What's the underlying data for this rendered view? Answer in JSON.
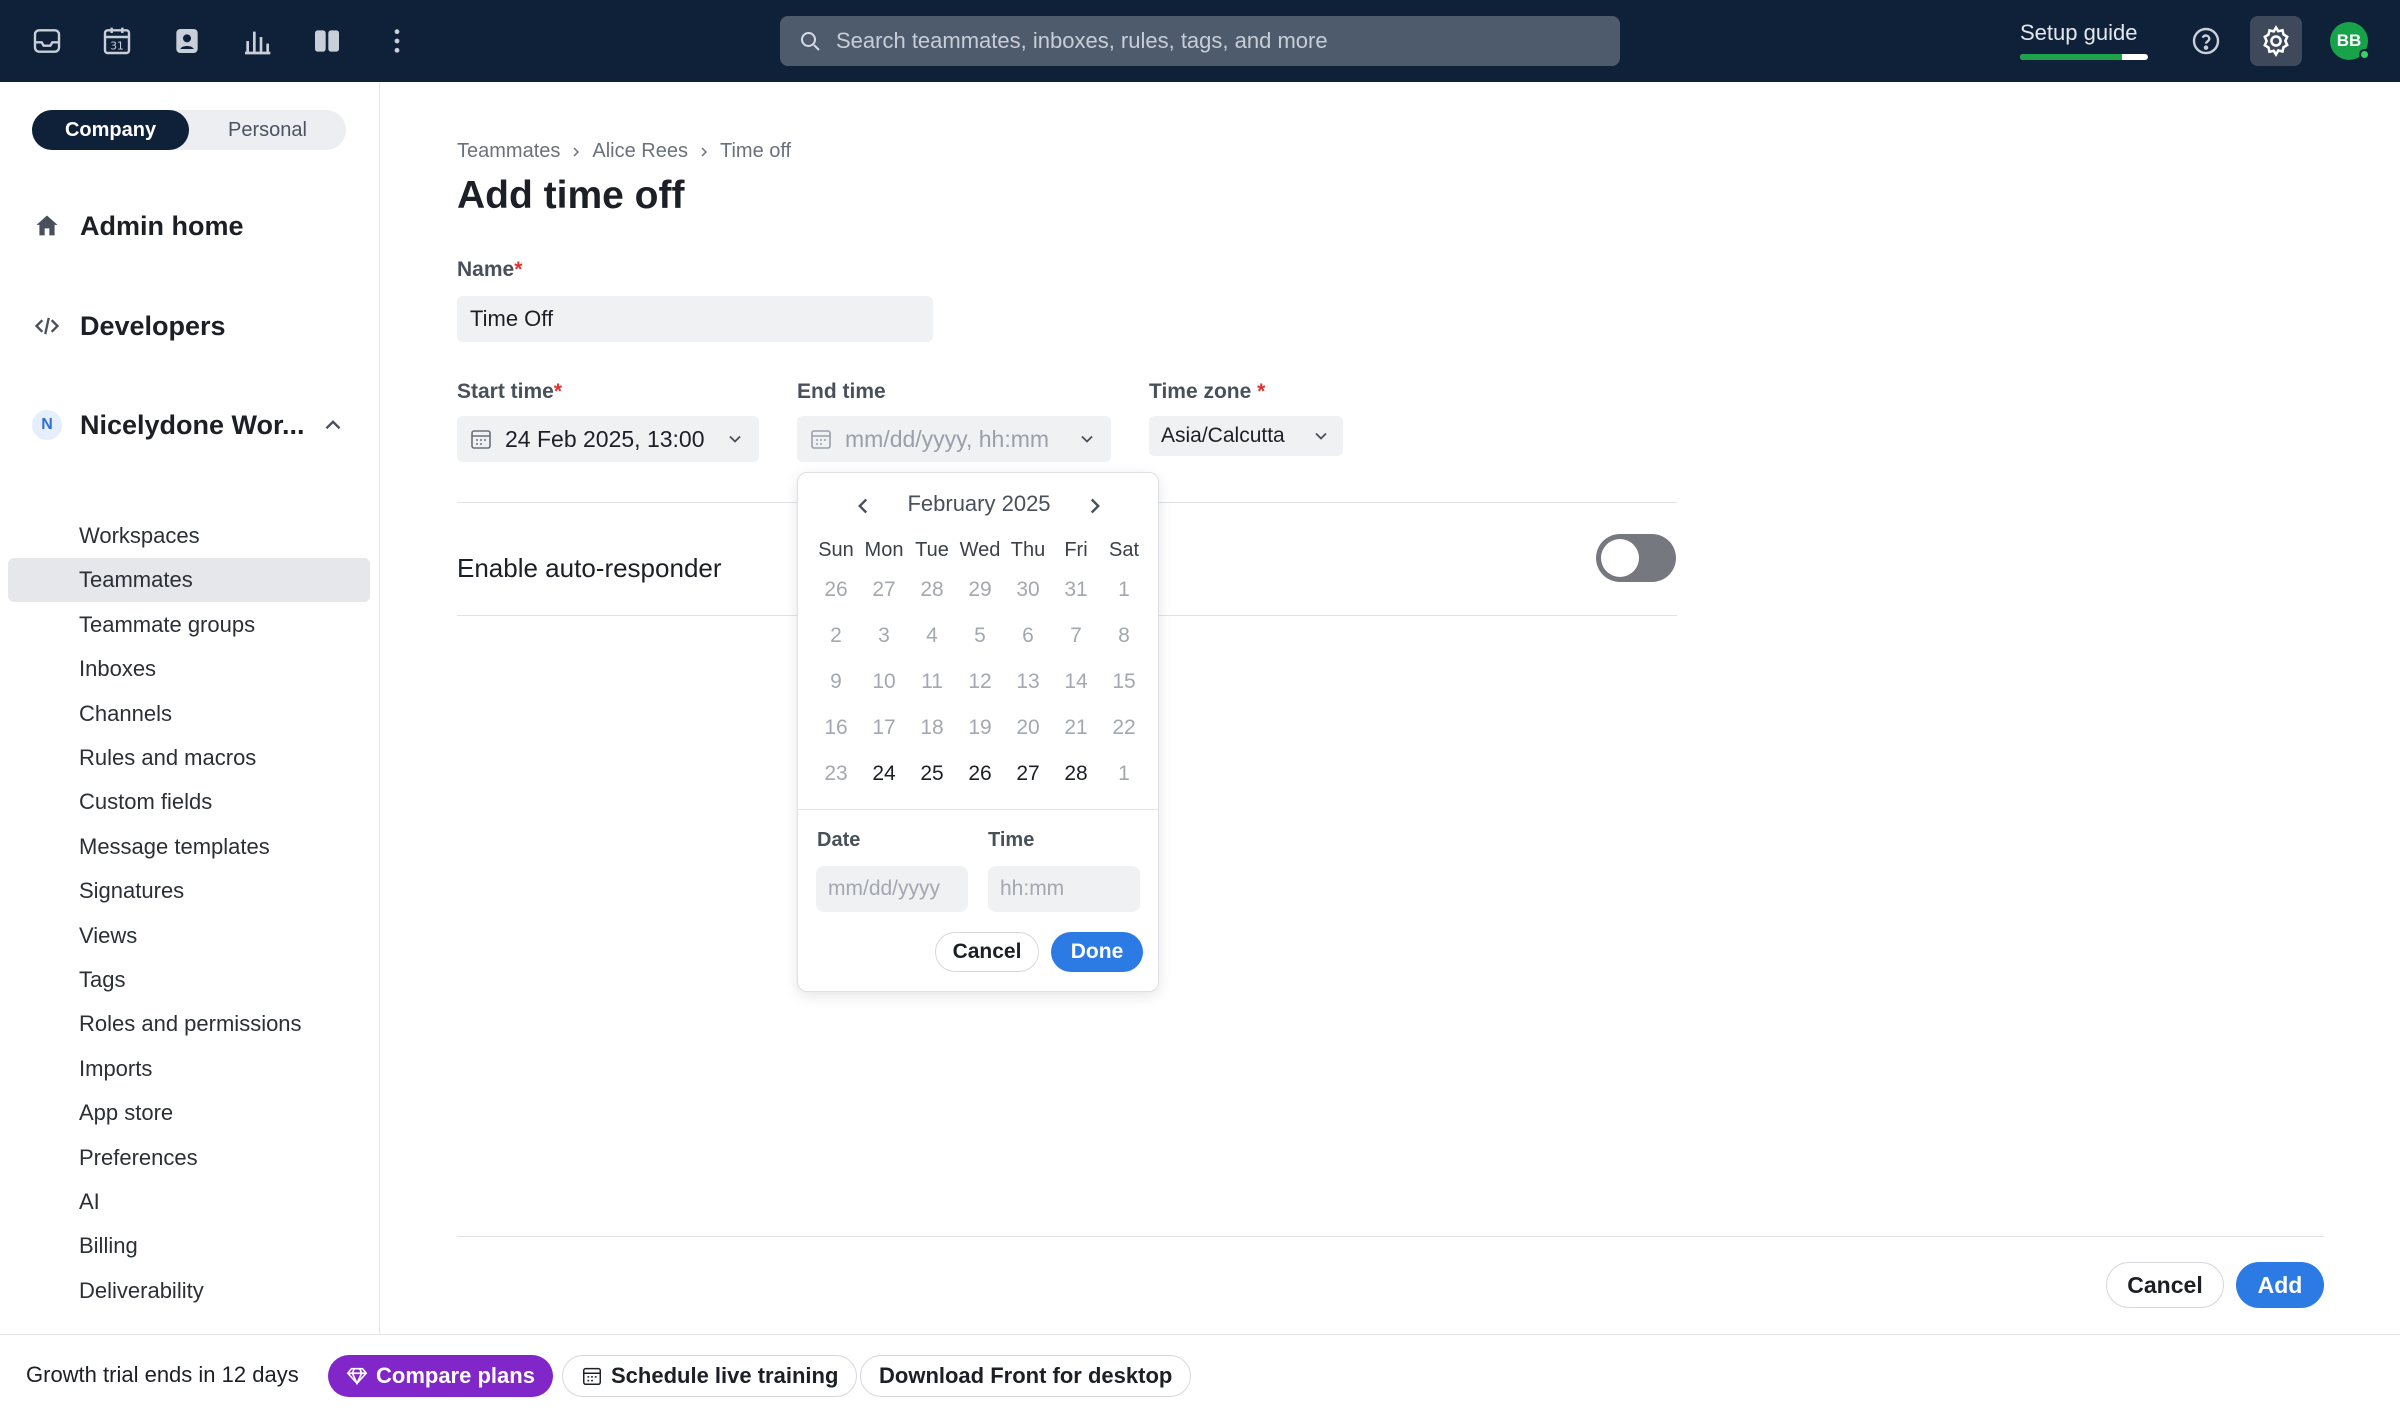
{
  "topbar": {
    "search_placeholder": "Search teammates, inboxes, rules, tags, and more",
    "setup_label": "Setup guide",
    "setup_progress": 0.8,
    "avatar_initials": "BB",
    "icons": [
      "inbox-icon",
      "calendar-icon",
      "contacts-icon",
      "analytics-icon",
      "layout-icon",
      "more-icon"
    ]
  },
  "sidebar": {
    "segment": {
      "company": "Company",
      "personal": "Personal"
    },
    "admin_home": "Admin home",
    "developers": "Developers",
    "workspace_badge": "N",
    "workspace_name": "Nicelydone Wor...",
    "items": [
      "Workspaces",
      "Teammates",
      "Teammate groups",
      "Inboxes",
      "Channels",
      "Rules and macros",
      "Custom fields",
      "Message templates",
      "Signatures",
      "Views",
      "Tags",
      "Roles and permissions",
      "Imports",
      "App store",
      "Preferences",
      "AI",
      "Billing",
      "Deliverability"
    ],
    "active_item": "Teammates"
  },
  "breadcrumb": [
    "Teammates",
    "Alice Rees",
    "Time off"
  ],
  "page_title": "Add time off",
  "form": {
    "name_label": "Name",
    "name_value": "Time Off",
    "start_label": "Start time",
    "start_value": "24 Feb 2025, 13:00",
    "end_label": "End time",
    "end_placeholder": "mm/dd/yyyy, hh:mm",
    "tz_label": "Time zone",
    "tz_value": "Asia/Calcutta",
    "auto_responder_label": "Enable auto-responder",
    "auto_responder_on": false
  },
  "datepicker": {
    "month_label": "February 2025",
    "weekdays": [
      "Sun",
      "Mon",
      "Tue",
      "Wed",
      "Thu",
      "Fri",
      "Sat"
    ],
    "days": [
      {
        "d": "26",
        "enabled": false
      },
      {
        "d": "27",
        "enabled": false
      },
      {
        "d": "28",
        "enabled": false
      },
      {
        "d": "29",
        "enabled": false
      },
      {
        "d": "30",
        "enabled": false
      },
      {
        "d": "31",
        "enabled": false
      },
      {
        "d": "1",
        "enabled": false
      },
      {
        "d": "2",
        "enabled": false
      },
      {
        "d": "3",
        "enabled": false
      },
      {
        "d": "4",
        "enabled": false
      },
      {
        "d": "5",
        "enabled": false
      },
      {
        "d": "6",
        "enabled": false
      },
      {
        "d": "7",
        "enabled": false
      },
      {
        "d": "8",
        "enabled": false
      },
      {
        "d": "9",
        "enabled": false
      },
      {
        "d": "10",
        "enabled": false
      },
      {
        "d": "11",
        "enabled": false
      },
      {
        "d": "12",
        "enabled": false
      },
      {
        "d": "13",
        "enabled": false
      },
      {
        "d": "14",
        "enabled": false
      },
      {
        "d": "15",
        "enabled": false
      },
      {
        "d": "16",
        "enabled": false
      },
      {
        "d": "17",
        "enabled": false
      },
      {
        "d": "18",
        "enabled": false
      },
      {
        "d": "19",
        "enabled": false
      },
      {
        "d": "20",
        "enabled": false
      },
      {
        "d": "21",
        "enabled": false
      },
      {
        "d": "22",
        "enabled": false
      },
      {
        "d": "23",
        "enabled": false
      },
      {
        "d": "24",
        "enabled": true
      },
      {
        "d": "25",
        "enabled": true
      },
      {
        "d": "26",
        "enabled": true
      },
      {
        "d": "27",
        "enabled": true
      },
      {
        "d": "28",
        "enabled": true
      },
      {
        "d": "1",
        "enabled": false
      }
    ],
    "date_label": "Date",
    "date_placeholder": "mm/dd/yyyy",
    "time_label": "Time",
    "time_placeholder": "hh:mm",
    "cancel": "Cancel",
    "done": "Done"
  },
  "footer": {
    "cancel": "Cancel",
    "add": "Add"
  },
  "bottombar": {
    "trial_text": "Growth trial ends in 12 days",
    "compare_plans": "Compare plans",
    "schedule_training": "Schedule live training",
    "download": "Download Front for desktop"
  },
  "colors": {
    "topbar_bg": "#0f2138",
    "primary": "#2c7be5",
    "purple": "#8126c8",
    "progress_green": "#1fa34a",
    "required": "#e0322f"
  }
}
